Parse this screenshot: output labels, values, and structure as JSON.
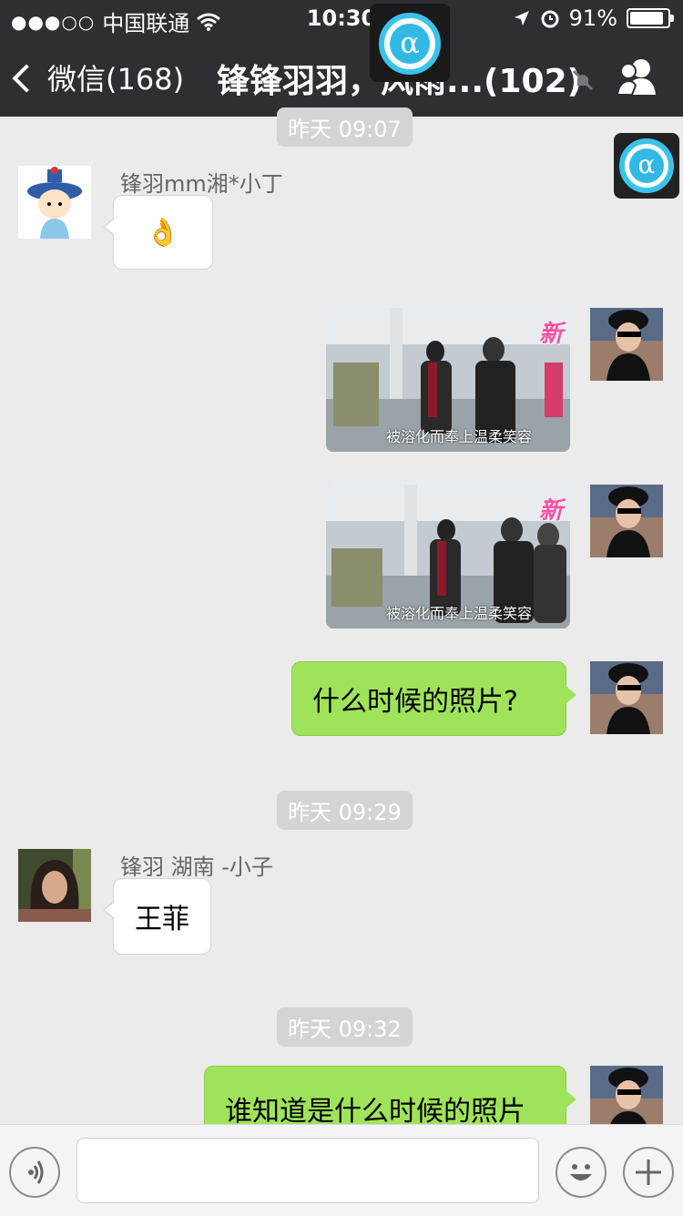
{
  "status_bar": {
    "signal": "●●●○○",
    "carrier": "中国联通",
    "time": "10:30",
    "battery": "91%",
    "battery_level": 0.91
  },
  "nav": {
    "back_label": "微信(168)",
    "title": "锋锋羽羽，风雨...(102)"
  },
  "timestamps": {
    "t1": "昨天 09:07",
    "t2": "昨天 09:29",
    "t3": "昨天 09:32"
  },
  "messages": {
    "m1": {
      "sender": "锋羽mm湘*小丁",
      "text": "👌"
    },
    "m2": {
      "caption": "被溶化而奉上温柔笑容",
      "logo": "新"
    },
    "m3": {
      "caption": "被溶化而奉上温柔笑容",
      "logo": "新"
    },
    "m4": {
      "text": "什么时候的照片?"
    },
    "m5": {
      "sender": "锋羽 湖南 -小子",
      "text": "王菲"
    },
    "m6": {
      "text": "谁知道是什么时候的照片"
    }
  },
  "colors": {
    "nav_bg": "#2e2e33",
    "chat_bg": "#ebebeb",
    "my_bubble": "#9fe35a",
    "alpha_accent": "#30b9e4"
  },
  "icons": {
    "voice": "voice-icon",
    "emoji": "emoji-icon",
    "plus": "plus-icon",
    "group": "group-icon",
    "mute": "mute-icon"
  }
}
